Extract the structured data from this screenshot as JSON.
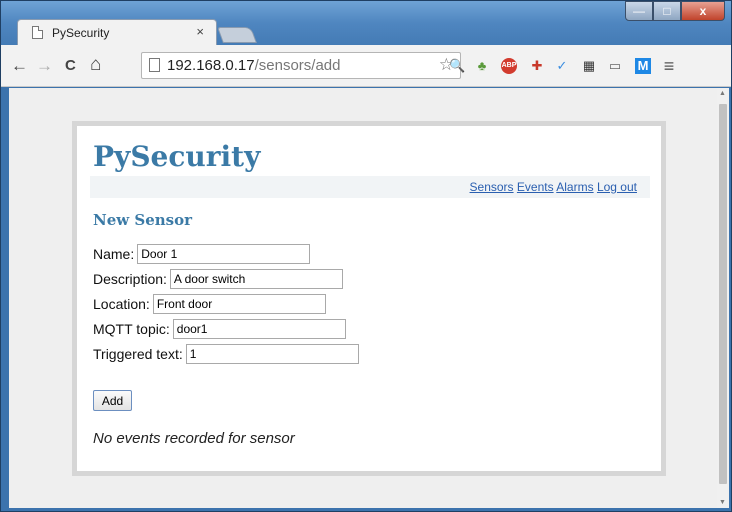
{
  "browser": {
    "tab_title": "PySecurity",
    "tab_close": "×",
    "url_host": "192.168.0.17",
    "url_path": "/sensors/add",
    "nav": {
      "back": "←",
      "forward": "→",
      "reload": "C",
      "home": "⌂"
    },
    "window_buttons": {
      "minimize": "—",
      "maximize": "□",
      "close": "x"
    },
    "extensions": [
      {
        "name": "search-extension-icon",
        "glyph": "🔍",
        "color": "#888888"
      },
      {
        "name": "evernote-icon",
        "glyph": "♣",
        "color": "#5a9a3a"
      },
      {
        "name": "adblock-plus-icon",
        "glyph": "ABP",
        "color": "#d23b2e"
      },
      {
        "name": "red-cross-icon",
        "glyph": "✚",
        "color": "#c8382a"
      },
      {
        "name": "check-icon",
        "glyph": "✓",
        "color": "#3a8de0"
      },
      {
        "name": "film-icon",
        "glyph": "▦",
        "color": "#333333"
      },
      {
        "name": "cast-icon",
        "glyph": "▭",
        "color": "#666666"
      },
      {
        "name": "m-icon",
        "glyph": "M",
        "color": "#1e88e5"
      },
      {
        "name": "menu-icon",
        "glyph": "≡",
        "color": "#555555"
      }
    ]
  },
  "page": {
    "logo": "PySecurity",
    "nav_links": [
      "Sensors",
      "Events",
      "Alarms",
      "Log out"
    ],
    "heading": "New Sensor",
    "fields": [
      {
        "label": "Name:",
        "value": "Door 1"
      },
      {
        "label": "Description:",
        "value": "A door switch"
      },
      {
        "label": "Location:",
        "value": "Front door"
      },
      {
        "label": "MQTT topic:",
        "value": "door1"
      },
      {
        "label": "Triggered text:",
        "value": "1"
      }
    ],
    "add_button": "Add",
    "note": "No events recorded for sensor"
  }
}
